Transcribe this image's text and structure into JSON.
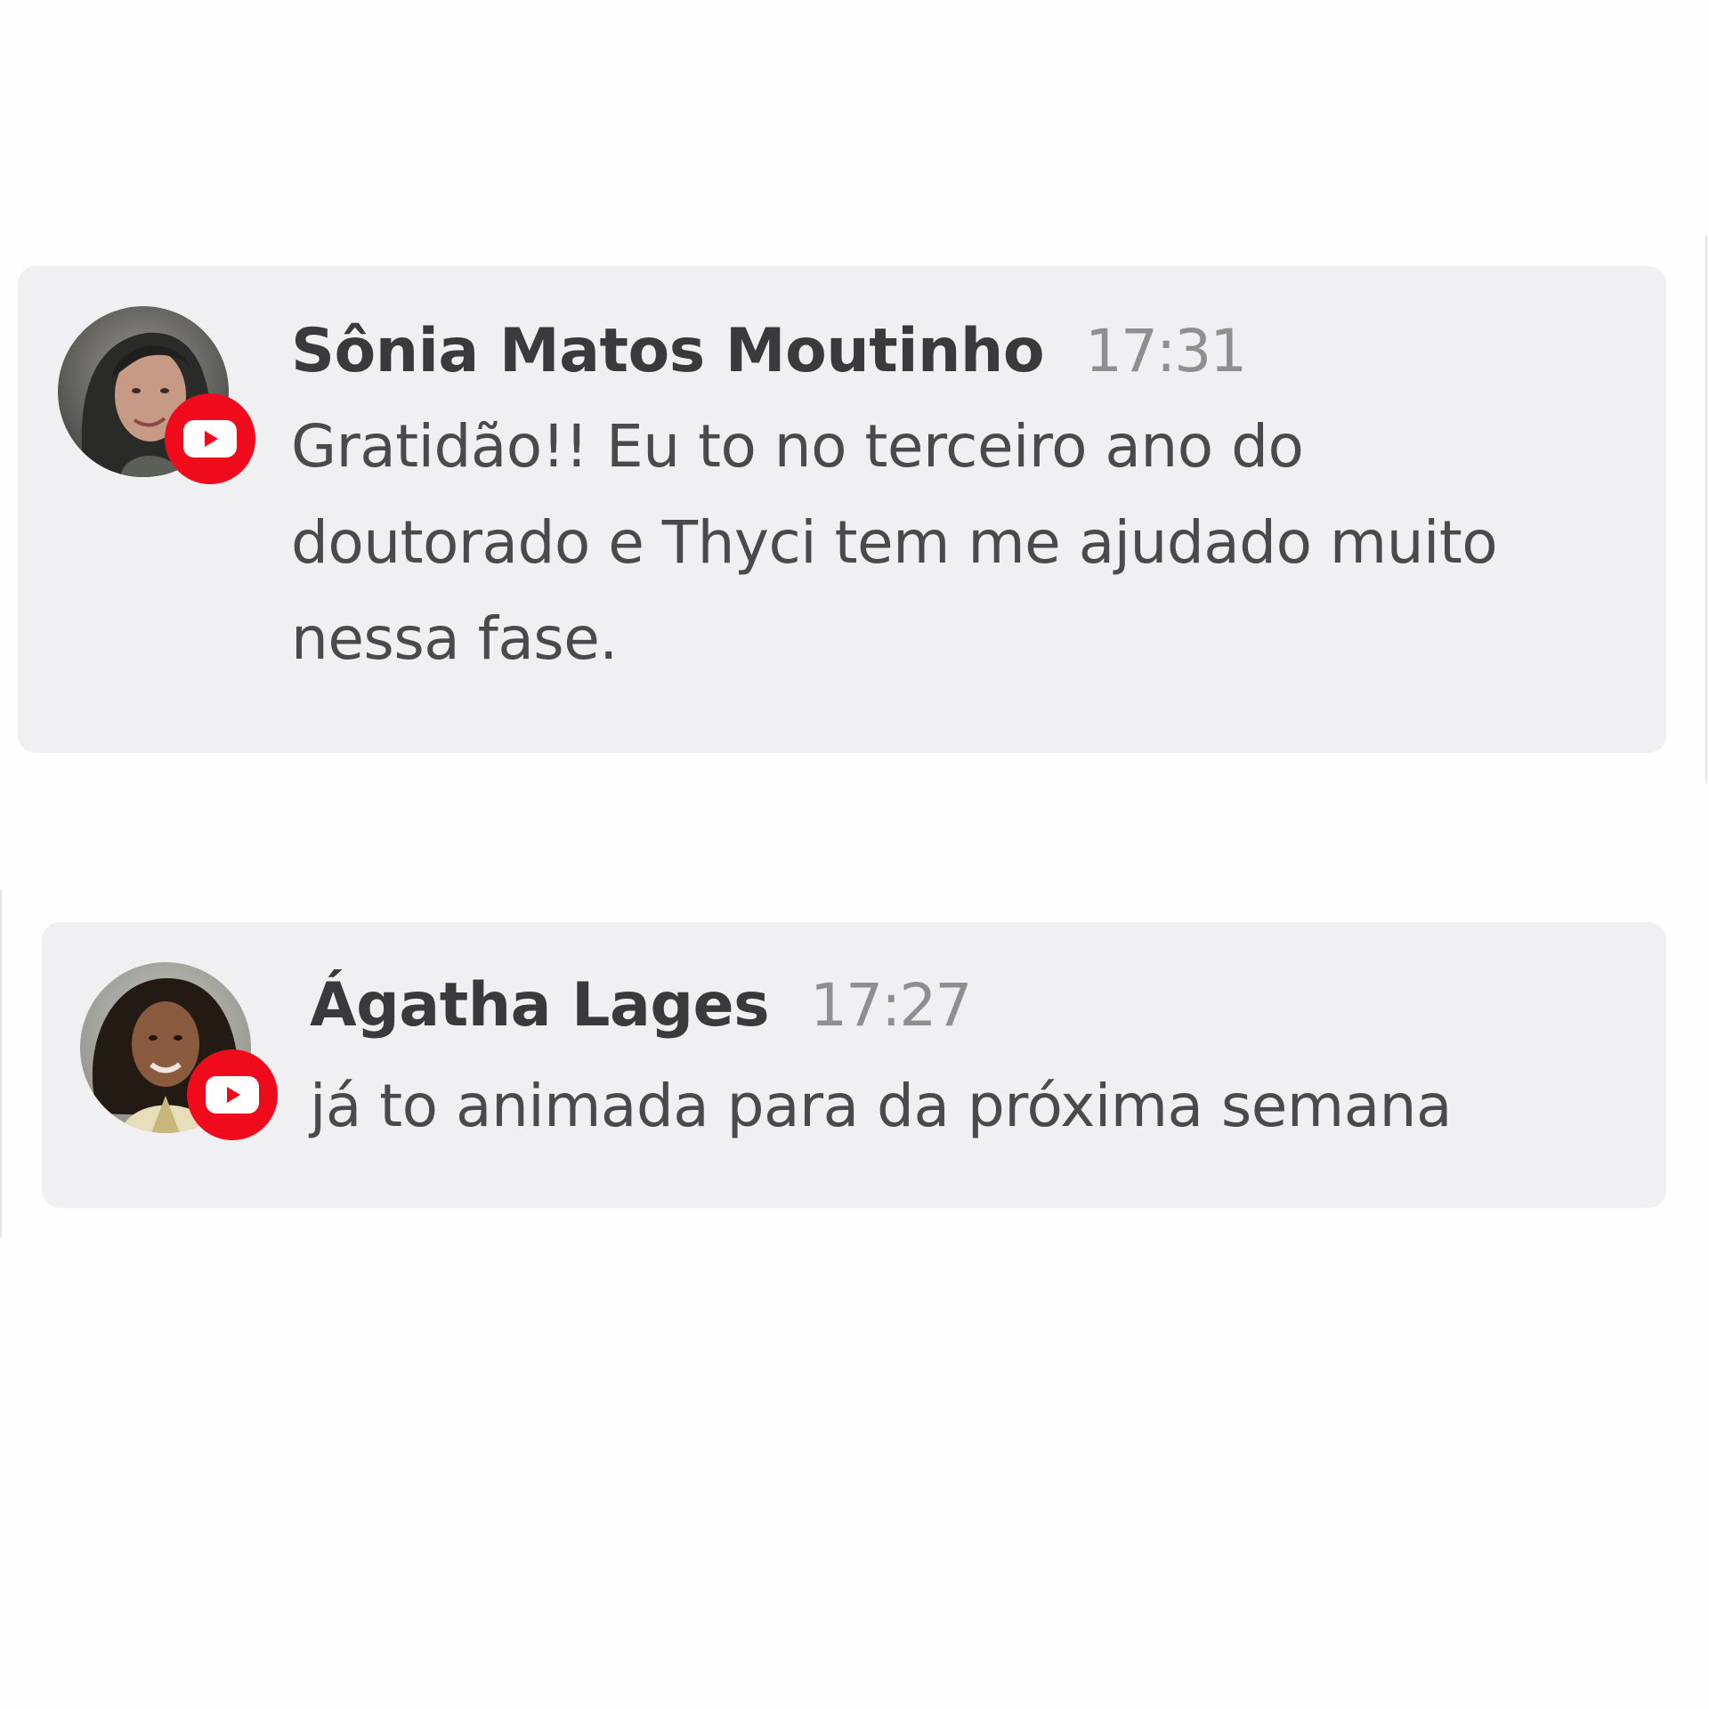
{
  "comments": [
    {
      "author": "Sônia Matos Moutinho",
      "time": "17:31",
      "text": "Gratidão!! Eu to no terceiro ano do doutorado e Thyci tem me ajudado muito nessa fase.",
      "avatar_icon": "user-photo",
      "source_icon": "youtube-icon"
    },
    {
      "author": "Ágatha Lages",
      "time": "17:27",
      "text": "já to animada para da próxima semana",
      "avatar_icon": "user-photo",
      "source_icon": "youtube-icon"
    }
  ],
  "colors": {
    "card_background": "#f0f0f2",
    "author_text": "#3a3a3c",
    "timestamp_text": "#8e8e93",
    "message_text": "#4a4a4c",
    "youtube_red": "#f00b1c"
  }
}
